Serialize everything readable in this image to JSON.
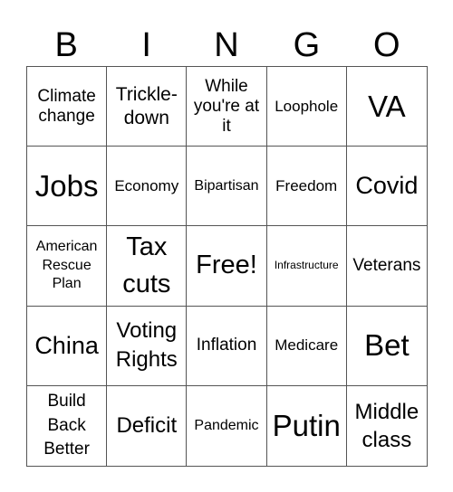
{
  "header": [
    "B",
    "I",
    "N",
    "G",
    "O"
  ],
  "cells": [
    "Climate change",
    "Trickle-down",
    "While you're at it",
    "Loophole",
    "VA",
    "Jobs",
    "Economy",
    "Bipartisan",
    "Freedom",
    "Covid",
    "American Rescue Plan",
    "Tax cuts",
    "Free!",
    "Infrastructure",
    "Veterans",
    "China",
    "Voting Rights",
    "Inflation",
    "Medicare",
    "Bet",
    "Build Back Better",
    "Deficit",
    "Pandemic",
    "Putin",
    "Middle class"
  ]
}
